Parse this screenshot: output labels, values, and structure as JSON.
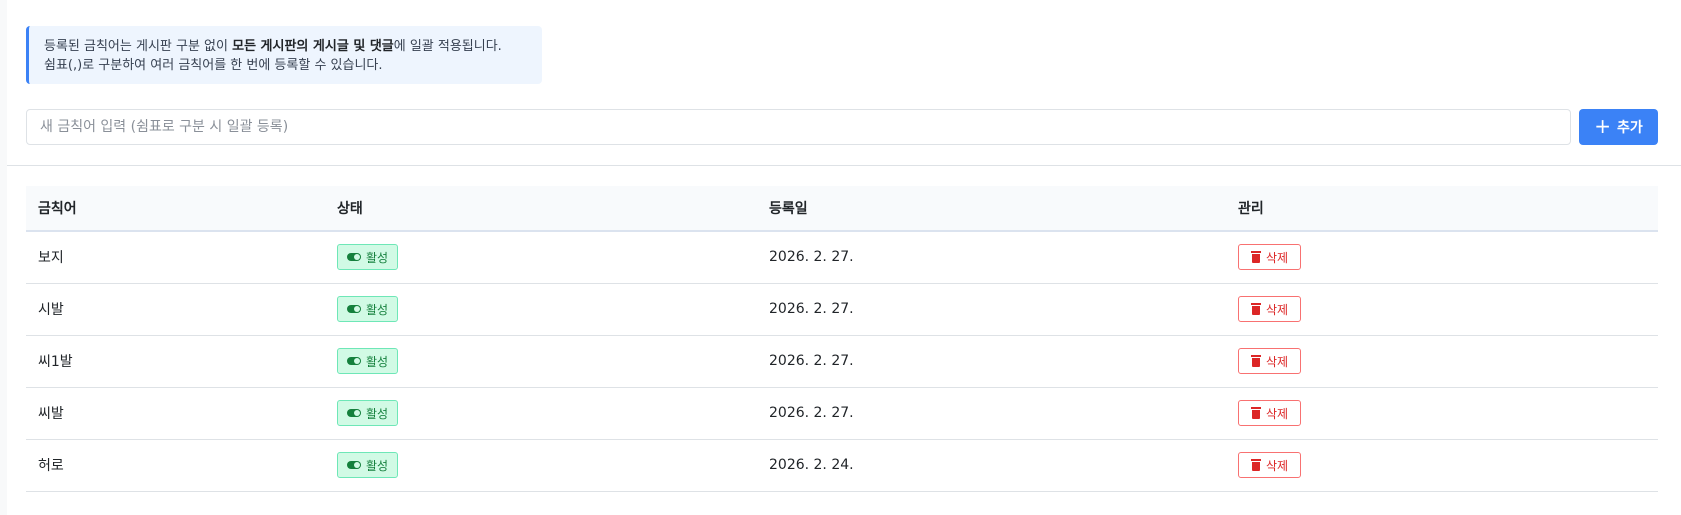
{
  "notice": {
    "line1_before": "등록된 금칙어는 게시판 구분 없이 ",
    "line1_bold": "모든 게시판의 게시글 및 댓글",
    "line1_after": "에 일괄 적용됩니다.",
    "line2": "쉼표(,)로 구분하여 여러 금칙어를 한 번에 등록할 수 있습니다."
  },
  "add_form": {
    "placeholder": "새 금칙어 입력 (쉼표로 구분 시 일괄 등록)",
    "value": "",
    "button_label": "추가",
    "button_icon": "plus-icon",
    "accent_color": "#3b82f6"
  },
  "table": {
    "headers": [
      "금칙어",
      "상태",
      "등록일",
      "관리"
    ],
    "rows": [
      {
        "word": "보지",
        "status": "활성",
        "date": "2026. 2. 27.",
        "action": "삭제"
      },
      {
        "word": "시발",
        "status": "활성",
        "date": "2026. 2. 27.",
        "action": "삭제"
      },
      {
        "word": "씨1발",
        "status": "활성",
        "date": "2026. 2. 27.",
        "action": "삭제"
      },
      {
        "word": "씨발",
        "status": "활성",
        "date": "2026. 2. 27.",
        "action": "삭제"
      },
      {
        "word": "허로",
        "status": "활성",
        "date": "2026. 2. 24.",
        "action": "삭제"
      }
    ],
    "status_icon": "toggle-on-icon",
    "action_icon": "trash-icon",
    "status_color": "#15803d",
    "action_color": "#dc2626"
  }
}
